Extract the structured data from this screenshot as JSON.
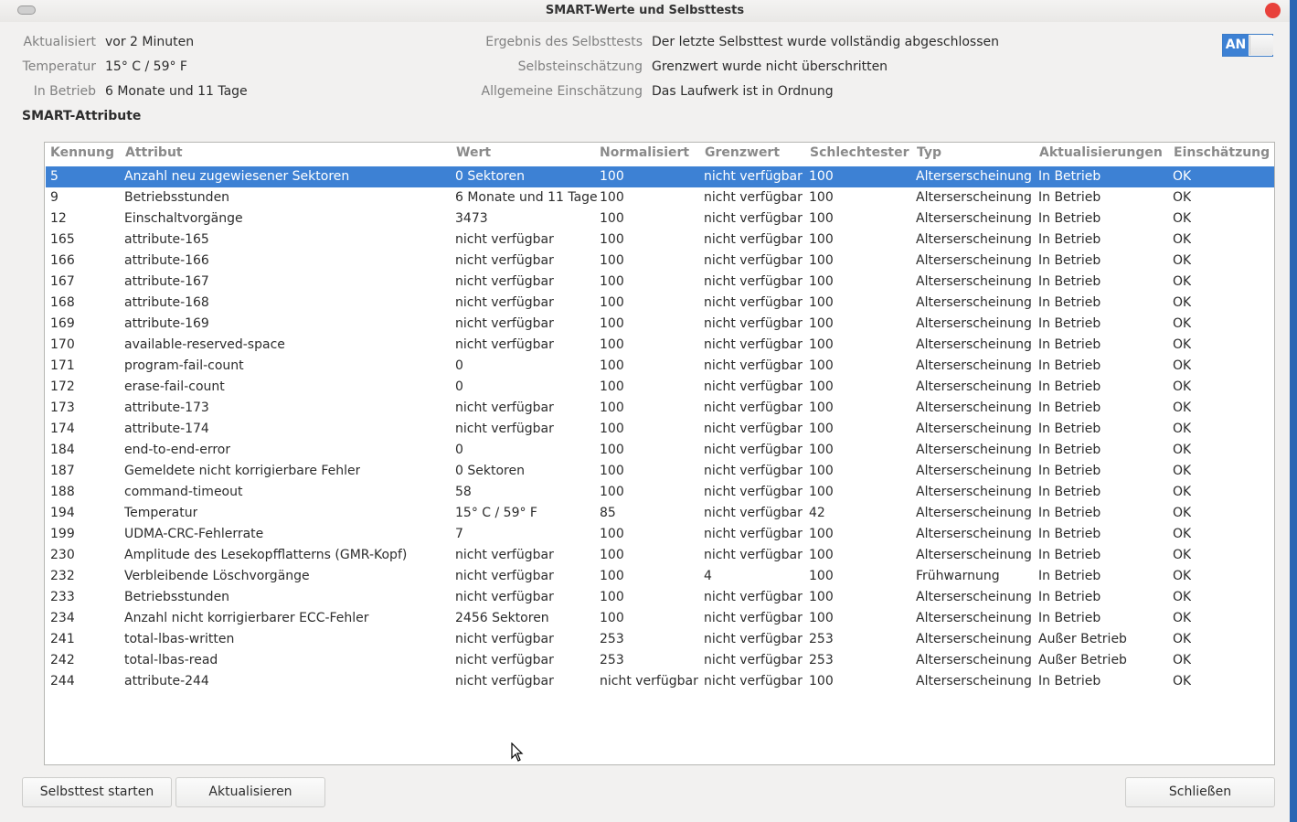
{
  "window": {
    "title": "SMART-Werte und Selbsttests"
  },
  "summary": {
    "left": [
      {
        "label": "Aktualisiert",
        "value": "vor 2 Minuten"
      },
      {
        "label": "Temperatur",
        "value": "15° C / 59° F"
      },
      {
        "label": "In Betrieb",
        "value": "6 Monate und 11 Tage"
      }
    ],
    "right": [
      {
        "label": "Ergebnis des Selbsttests",
        "value": "Der letzte Selbsttest wurde vollständig abgeschlossen"
      },
      {
        "label": "Selbsteinschätzung",
        "value": "Grenzwert wurde nicht überschritten"
      },
      {
        "label": "Allgemeine Einschätzung",
        "value": "Das Laufwerk ist in Ordnung"
      }
    ],
    "toggle_label": "AN"
  },
  "section_title": "SMART-Attribute",
  "table": {
    "headers": [
      "Kennung",
      "Attribut",
      "Wert",
      "Normalisiert",
      "Grenzwert",
      "Schlechtester",
      "Typ",
      "Aktualisierungen",
      "Einschätzung"
    ],
    "rows": [
      [
        "5",
        "Anzahl neu zugewiesener Sektoren",
        "0 Sektoren",
        "100",
        "nicht verfügbar",
        "100",
        "Alterserscheinung",
        "In Betrieb",
        "OK"
      ],
      [
        "9",
        "Betriebsstunden",
        "6 Monate und 11 Tage",
        "100",
        "nicht verfügbar",
        "100",
        "Alterserscheinung",
        "In Betrieb",
        "OK"
      ],
      [
        "12",
        "Einschaltvorgänge",
        "3473",
        "100",
        "nicht verfügbar",
        "100",
        "Alterserscheinung",
        "In Betrieb",
        "OK"
      ],
      [
        "165",
        "attribute-165",
        "nicht verfügbar",
        "100",
        "nicht verfügbar",
        "100",
        "Alterserscheinung",
        "In Betrieb",
        "OK"
      ],
      [
        "166",
        "attribute-166",
        "nicht verfügbar",
        "100",
        "nicht verfügbar",
        "100",
        "Alterserscheinung",
        "In Betrieb",
        "OK"
      ],
      [
        "167",
        "attribute-167",
        "nicht verfügbar",
        "100",
        "nicht verfügbar",
        "100",
        "Alterserscheinung",
        "In Betrieb",
        "OK"
      ],
      [
        "168",
        "attribute-168",
        "nicht verfügbar",
        "100",
        "nicht verfügbar",
        "100",
        "Alterserscheinung",
        "In Betrieb",
        "OK"
      ],
      [
        "169",
        "attribute-169",
        "nicht verfügbar",
        "100",
        "nicht verfügbar",
        "100",
        "Alterserscheinung",
        "In Betrieb",
        "OK"
      ],
      [
        "170",
        "available-reserved-space",
        "nicht verfügbar",
        "100",
        "nicht verfügbar",
        "100",
        "Alterserscheinung",
        "In Betrieb",
        "OK"
      ],
      [
        "171",
        "program-fail-count",
        "0",
        "100",
        "nicht verfügbar",
        "100",
        "Alterserscheinung",
        "In Betrieb",
        "OK"
      ],
      [
        "172",
        "erase-fail-count",
        "0",
        "100",
        "nicht verfügbar",
        "100",
        "Alterserscheinung",
        "In Betrieb",
        "OK"
      ],
      [
        "173",
        "attribute-173",
        "nicht verfügbar",
        "100",
        "nicht verfügbar",
        "100",
        "Alterserscheinung",
        "In Betrieb",
        "OK"
      ],
      [
        "174",
        "attribute-174",
        "nicht verfügbar",
        "100",
        "nicht verfügbar",
        "100",
        "Alterserscheinung",
        "In Betrieb",
        "OK"
      ],
      [
        "184",
        "end-to-end-error",
        "0",
        "100",
        "nicht verfügbar",
        "100",
        "Alterserscheinung",
        "In Betrieb",
        "OK"
      ],
      [
        "187",
        "Gemeldete nicht korrigierbare Fehler",
        "0 Sektoren",
        "100",
        "nicht verfügbar",
        "100",
        "Alterserscheinung",
        "In Betrieb",
        "OK"
      ],
      [
        "188",
        "command-timeout",
        "58",
        "100",
        "nicht verfügbar",
        "100",
        "Alterserscheinung",
        "In Betrieb",
        "OK"
      ],
      [
        "194",
        "Temperatur",
        "15° C / 59° F",
        "85",
        "nicht verfügbar",
        "42",
        "Alterserscheinung",
        "In Betrieb",
        "OK"
      ],
      [
        "199",
        "UDMA-CRC-Fehlerrate",
        "7",
        "100",
        "nicht verfügbar",
        "100",
        "Alterserscheinung",
        "In Betrieb",
        "OK"
      ],
      [
        "230",
        "Amplitude des Lesekopfflatterns (GMR-Kopf)",
        "nicht verfügbar",
        "100",
        "nicht verfügbar",
        "100",
        "Alterserscheinung",
        "In Betrieb",
        "OK"
      ],
      [
        "232",
        "Verbleibende Löschvorgänge",
        "nicht verfügbar",
        "100",
        "4",
        "100",
        "Frühwarnung",
        "In Betrieb",
        "OK"
      ],
      [
        "233",
        "Betriebsstunden",
        "nicht verfügbar",
        "100",
        "nicht verfügbar",
        "100",
        "Alterserscheinung",
        "In Betrieb",
        "OK"
      ],
      [
        "234",
        "Anzahl nicht korrigierbarer ECC-Fehler",
        "2456 Sektoren",
        "100",
        "nicht verfügbar",
        "100",
        "Alterserscheinung",
        "In Betrieb",
        "OK"
      ],
      [
        "241",
        "total-lbas-written",
        "nicht verfügbar",
        "253",
        "nicht verfügbar",
        "253",
        "Alterserscheinung",
        "Außer Betrieb",
        "OK"
      ],
      [
        "242",
        "total-lbas-read",
        "nicht verfügbar",
        "253",
        "nicht verfügbar",
        "253",
        "Alterserscheinung",
        "Außer Betrieb",
        "OK"
      ],
      [
        "244",
        "attribute-244",
        "nicht verfügbar",
        "nicht verfügbar",
        "nicht verfügbar",
        "100",
        "Alterserscheinung",
        "In Betrieb",
        "OK"
      ]
    ],
    "selected_row": 0
  },
  "buttons": {
    "selftest": "Selbsttest starten",
    "refresh": "Aktualisieren",
    "close": "Schließen"
  },
  "colors": {
    "accent": "#3d81d4",
    "close": "#e8413b"
  }
}
